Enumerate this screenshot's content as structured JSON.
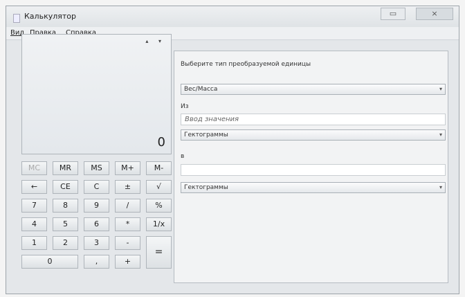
{
  "window": {
    "title": "Калькулятор",
    "minimize_symbol": "▭",
    "close_symbol": "×"
  },
  "menu": {
    "items": [
      "Вид",
      "Правка",
      "Справка"
    ]
  },
  "display": {
    "arrows": "▴ ▾",
    "value": "0"
  },
  "keypad": {
    "memory": [
      "MC",
      "MR",
      "MS",
      "M+",
      "M-"
    ],
    "row2": [
      "←",
      "CE",
      "C",
      "±",
      "√"
    ],
    "row3": [
      "7",
      "8",
      "9",
      "/",
      "%"
    ],
    "row4": [
      "4",
      "5",
      "6",
      "*",
      "1/x"
    ],
    "row5": [
      "1",
      "2",
      "3",
      "-"
    ],
    "equals": "=",
    "row6": [
      "0",
      ",",
      "+"
    ]
  },
  "converter": {
    "prompt": "Выберите тип преобразуемой единицы",
    "type_value": "Вес/Масса",
    "from_label": "Из",
    "from_placeholder": "Ввод значения",
    "from_unit": "Гектограммы",
    "to_label": "в",
    "to_value": "",
    "to_unit": "Гектограммы",
    "dropdown_symbol": "▾"
  }
}
